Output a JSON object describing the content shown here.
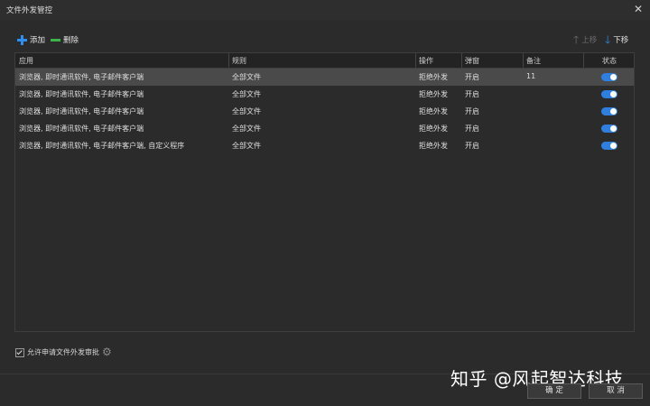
{
  "window": {
    "title": "文件外发管控",
    "close": "✕"
  },
  "toolbar": {
    "add": "添加",
    "delete": "删除",
    "up": "上移",
    "down": "下移"
  },
  "table": {
    "headers": [
      "应用",
      "规则",
      "操作",
      "弹窗",
      "备注",
      "状态"
    ],
    "rows": [
      {
        "app": "浏览器, 即时通讯软件, 电子邮件客户端",
        "rule": "全部文件",
        "action": "拒绝外发",
        "popup": "开启",
        "note": "11",
        "enabled": true
      },
      {
        "app": "浏览器, 即时通讯软件, 电子邮件客户端",
        "rule": "全部文件",
        "action": "拒绝外发",
        "popup": "开启",
        "note": "",
        "enabled": true
      },
      {
        "app": "浏览器, 即时通讯软件, 电子邮件客户端",
        "rule": "全部文件",
        "action": "拒绝外发",
        "popup": "开启",
        "note": "",
        "enabled": true
      },
      {
        "app": "浏览器, 即时通讯软件, 电子邮件客户端",
        "rule": "全部文件",
        "action": "拒绝外发",
        "popup": "开启",
        "note": "",
        "enabled": true
      },
      {
        "app": "浏览器, 即时通讯软件, 电子邮件客户端, 自定义程序",
        "rule": "全部文件",
        "action": "拒绝外发",
        "popup": "开启",
        "note": "",
        "enabled": true
      }
    ]
  },
  "footer": {
    "allow_label": "允许申请文件外发审批",
    "allow_checked": true,
    "ok": "确 定",
    "cancel": "取 消",
    "watermark": "知乎 @风起智达科技"
  },
  "colors": {
    "accent": "#2f8ff0",
    "delete": "#3cb44b",
    "toggle_on": "#2f7fe0",
    "background": "#2b2b2b"
  }
}
